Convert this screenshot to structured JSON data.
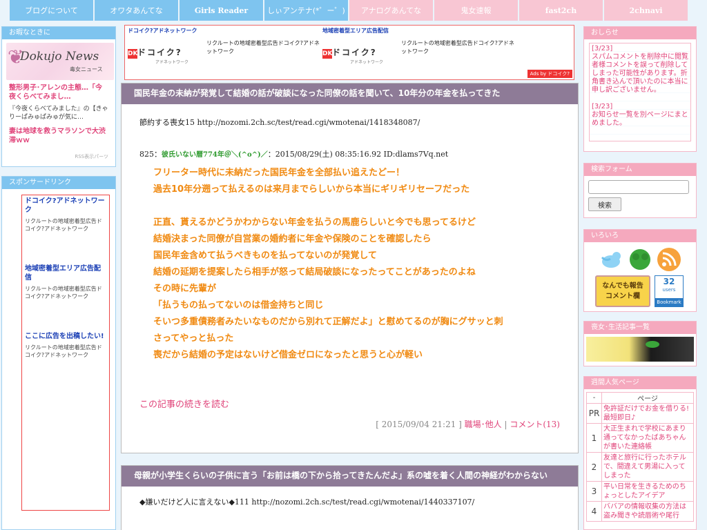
{
  "nav": [
    {
      "label": "ブログについて",
      "style": "blue"
    },
    {
      "label": "オワタあんてな",
      "style": "blue"
    },
    {
      "label": "Girls Reader",
      "style": "blue bold"
    },
    {
      "label": "しぃアンテナ(*゜ー゜)",
      "style": "blue"
    },
    {
      "label": "アナログあんてな",
      "style": "pink"
    },
    {
      "label": "鬼女速報",
      "style": "pink"
    },
    {
      "label": "fast2ch",
      "style": "pink bold"
    },
    {
      "label": "2chnavi",
      "style": "pink bold"
    }
  ],
  "left": {
    "boring_header": "お暇なときに",
    "logo_title": "Dokujo News",
    "logo_sub": "毒女ニュース",
    "link1": "整形男子･アレンの主態…「今夜くらべてみまし…",
    "desc1": "『今夜くらべてみました』の【きゃりーぱみゅぱみゅが気に…",
    "link2": "妻は地球を救うマラソンで大渋滞ｗｗ",
    "rss": "RSS表示パーツ",
    "sponsor_header": "スポンサードリンク",
    "sponsors": [
      {
        "title": "ドコイク?アドネットワーク",
        "desc": "リクルートの地域密着型広告ドコイク?アドネットワーク"
      },
      {
        "title": "地域密着型エリア広告配信",
        "desc": "リクルートの地域密着型広告ドコイク?アドネットワーク"
      },
      {
        "title": "ここに広告を出稿したい!",
        "desc": "リクルートの地域密着型広告ドコイク?アドネットワーク"
      }
    ]
  },
  "ads": {
    "col1_title": "ドコイク?アドネットワーク",
    "col1_text": "リクルートの地域密着型広告ドコイク?アドネットワーク",
    "col2_title": "地域密着型エリア広告配信",
    "col2_text": "リクルートの地域密着型広告ドコイク?アドネットワーク",
    "logo_k": "DK",
    "logo_name": "ドコイク?",
    "logo_sub": "アドネットワーク",
    "ads_by": "Ads by ドコイク?"
  },
  "post1": {
    "title": "国民年金の未納が発覚して結婚の話が破談になった同僚の話を聞いて、10年分の年金を払ってきた",
    "source": "節約する喪女15 http://nozomi.2ch.sc/test/read.cgi/wmotenai/1418348087/",
    "res_num": "825：",
    "res_name": "彼氏いない暦774年＠＼(^o^)／",
    "res_info": "：2015/08/29(土) 08:35:16.92 ID:dlams7Vq.net",
    "lines": [
      "フリーター時代に未納だった国民年金を全部払い追えたどー！",
      "過去10年分遡って払えるのは来月までらしいから本当にギリギリセーフだった",
      "",
      "正直、貰えるかどうかわからない年金を払うの馬鹿らしいと今でも思ってるけど",
      "結婚決まった同僚が自営業の婚約者に年金や保険のことを確認したら",
      "国民年金含めて払うべきものを払ってないのが発覚して",
      "結婚の延期を提案したら相手が怒って結局破談になったってことがあったのよね",
      "その時に先輩が",
      "「払うもの払ってないのは借金持ちと同じ",
      "そいつ多重債務者みたいなものだから別れて正解だよ」と慰めてるのが胸にグサッと刺",
      "さってやっと払った",
      "喪だから結婚の予定はないけど借金ゼロになったと思うと心が軽い"
    ],
    "more": "この記事の続きを読む",
    "date": "[ 2015/09/04 21:21 ]",
    "category": "職場･他人",
    "comments": "コメント(13)"
  },
  "post2": {
    "title": "母親が小学生くらいの子供に言う「お前は橋の下から拾ってきたんだよ」系の嘘を着く人間の神経がわからない",
    "source": "◆嫌いだけど人に言えない◆111 http://nozomi.2ch.sc/test/read.cgi/wmotenai/1440337107/"
  },
  "right": {
    "notice_header": "おしらせ",
    "notice1_date": "[3/23]",
    "notice1": "スパムコメントを削除中に閲覧者様コメントを誤って削除してしまった可能性があります。折角書き込んで頂いたのに本当に申し訳ございません。",
    "notice2_date": "[3/23]",
    "notice2": "お知らせ一覧を別ページにまとめました。",
    "search_header": "検索フォーム",
    "search_btn": "検索",
    "misc_header": "いろいろ",
    "report_l1": "なんでも報告",
    "report_l2": "コメント欄",
    "hatena_count": "32",
    "hatena_users": "users",
    "hatena_label": "Bookmark",
    "category_header": "喪女･生活記事一覧",
    "ranking_header": "週間人気ページ",
    "rank_col_dash": "-",
    "rank_col_page": "ページ",
    "ranks": [
      {
        "n": "PR",
        "t": "免許証だけでお金を借りる!最短即日♪"
      },
      {
        "n": "1",
        "t": "大正生まれで学校にあまり通ってなかったばあちゃんが書いた連絡帳"
      },
      {
        "n": "2",
        "t": "友達と旅行に行ったホテルで、間違えて男湯に入ってしまった"
      },
      {
        "n": "3",
        "t": "平い日常を生きるためのちょっとしたアイデア"
      },
      {
        "n": "4",
        "t": "ババアの情報収集の方法は盗み聞きや読唇術や尾行"
      }
    ]
  },
  "colors": {
    "blue": "#7ec4ef",
    "pink": "#f5a9be",
    "title_bg": "#8e7b97",
    "quote": "#f08a12",
    "link": "#e0447a"
  }
}
